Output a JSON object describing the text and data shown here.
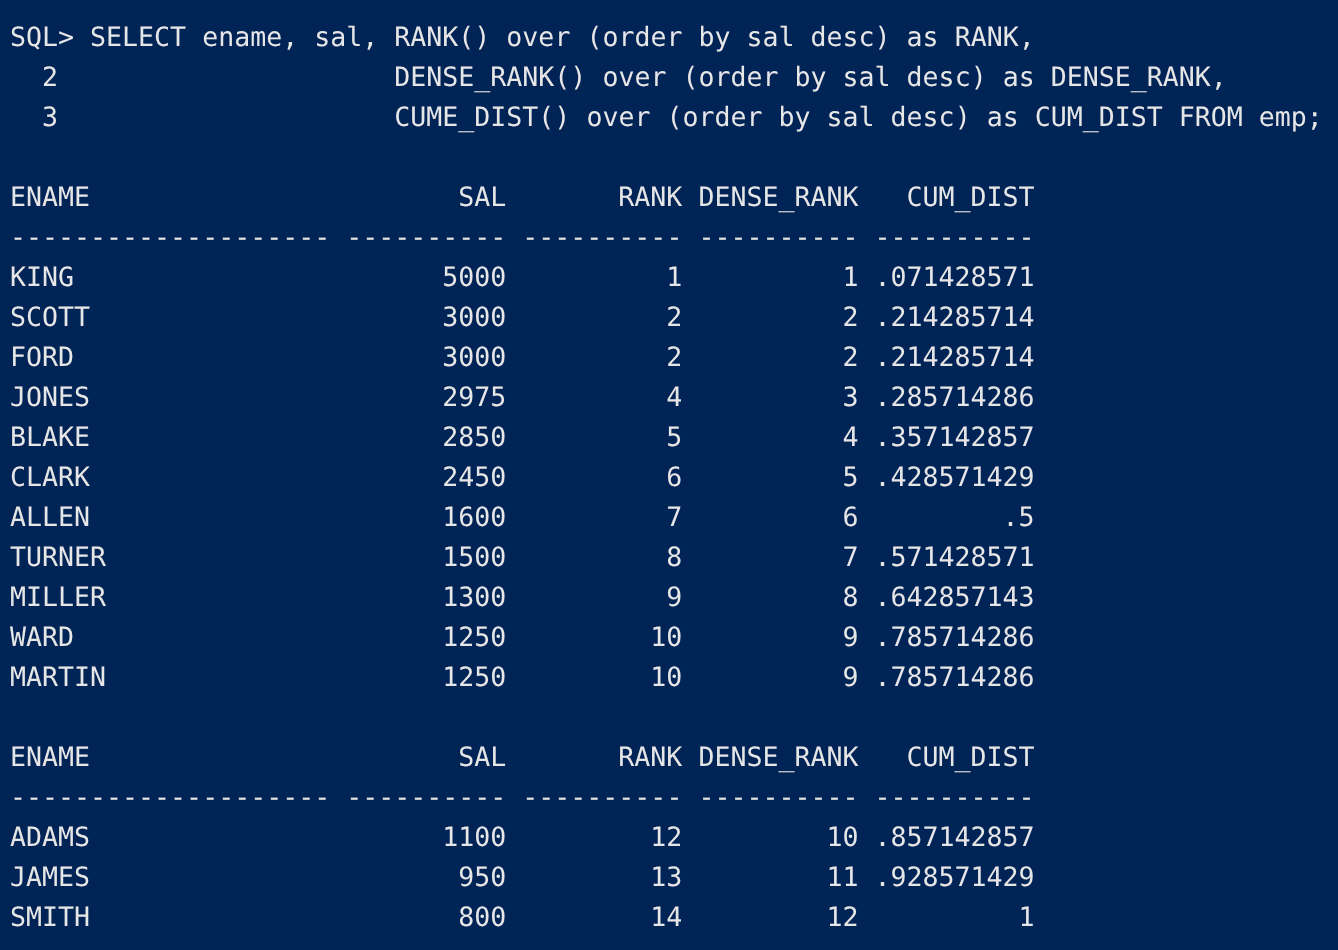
{
  "query": [
    {
      "kind": "prompt",
      "prompt": "SQL>",
      "text": "SELECT ename, sal, RANK() over (order by sal desc) as RANK,"
    },
    {
      "kind": "continuation",
      "prompt": "2",
      "text": "DENSE_RANK() over (order by sal desc) as DENSE_RANK,"
    },
    {
      "kind": "continuation",
      "prompt": "3",
      "text": "CUME_DIST() over (order by sal desc) as CUM_DIST FROM emp;"
    }
  ],
  "result_pages": [
    {
      "columns": [
        {
          "heading": "ENAME",
          "rule": "--------------------"
        },
        {
          "heading": "SAL",
          "rule": "----------"
        },
        {
          "heading": "RANK",
          "rule": "----------"
        },
        {
          "heading": "DENSE_RANK",
          "rule": "----------"
        },
        {
          "heading": "CUM_DIST",
          "rule": "----------"
        }
      ],
      "rows": [
        [
          "KING",
          "5000",
          "1",
          "1",
          ".071428571"
        ],
        [
          "SCOTT",
          "3000",
          "2",
          "2",
          ".214285714"
        ],
        [
          "FORD",
          "3000",
          "2",
          "2",
          ".214285714"
        ],
        [
          "JONES",
          "2975",
          "4",
          "3",
          ".285714286"
        ],
        [
          "BLAKE",
          "2850",
          "5",
          "4",
          ".357142857"
        ],
        [
          "CLARK",
          "2450",
          "6",
          "5",
          ".428571429"
        ],
        [
          "ALLEN",
          "1600",
          "7",
          "6",
          ".5"
        ],
        [
          "TURNER",
          "1500",
          "8",
          "7",
          ".571428571"
        ],
        [
          "MILLER",
          "1300",
          "9",
          "8",
          ".642857143"
        ],
        [
          "WARD",
          "1250",
          "10",
          "9",
          ".785714286"
        ],
        [
          "MARTIN",
          "1250",
          "10",
          "9",
          ".785714286"
        ]
      ]
    },
    {
      "columns": [
        {
          "heading": "ENAME",
          "rule": "--------------------"
        },
        {
          "heading": "SAL",
          "rule": "----------"
        },
        {
          "heading": "RANK",
          "rule": "----------"
        },
        {
          "heading": "DENSE_RANK",
          "rule": "----------"
        },
        {
          "heading": "CUM_DIST",
          "rule": "----------"
        }
      ],
      "rows": [
        [
          "ADAMS",
          "1100",
          "12",
          "10",
          ".857142857"
        ],
        [
          "JAMES",
          "950",
          "13",
          "11",
          ".928571429"
        ],
        [
          "SMITH",
          "800",
          "14",
          "12",
          "1"
        ]
      ]
    }
  ]
}
